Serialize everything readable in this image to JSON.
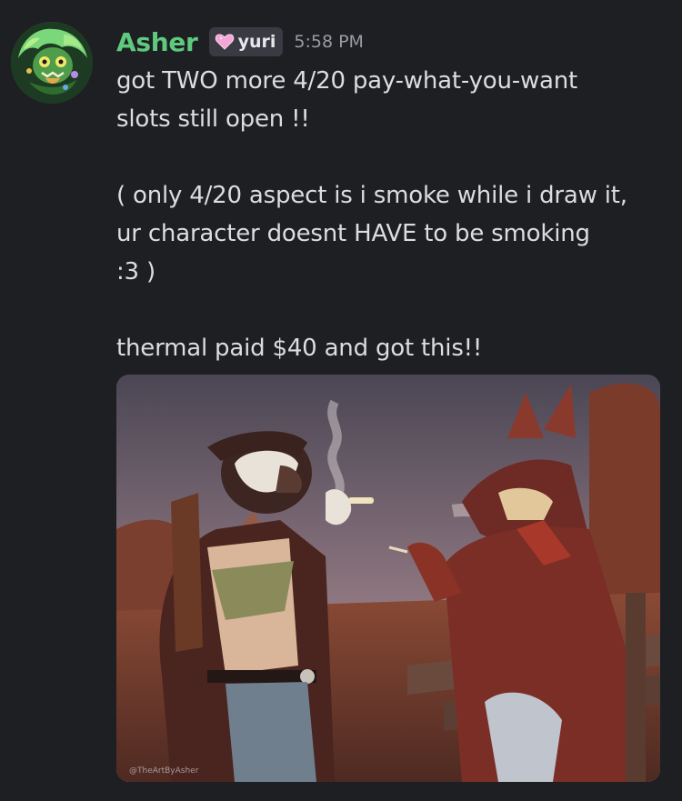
{
  "message": {
    "author": "Asher",
    "role_tag": {
      "label": "yuri",
      "icon": "heart-icon",
      "icon_color": "#f4a6d7"
    },
    "timestamp": "5:58 PM",
    "lines": [
      "got TWO more 4/20 pay-what-you-want",
      "slots still open !!",
      "",
      "( only 4/20 aspect is i smoke while i draw it,",
      "ur character doesnt HAVE to be smoking",
      ":3 )",
      "",
      "thermal paid $40 and got this!!"
    ],
    "attachment": {
      "watermark": "@TheArtByAsher"
    }
  },
  "colors": {
    "background": "#1e1f23",
    "username": "#5fc97e",
    "text": "#dcdde1",
    "timestamp": "#9a9ba3",
    "role_tag_bg": "#3a3b42"
  }
}
